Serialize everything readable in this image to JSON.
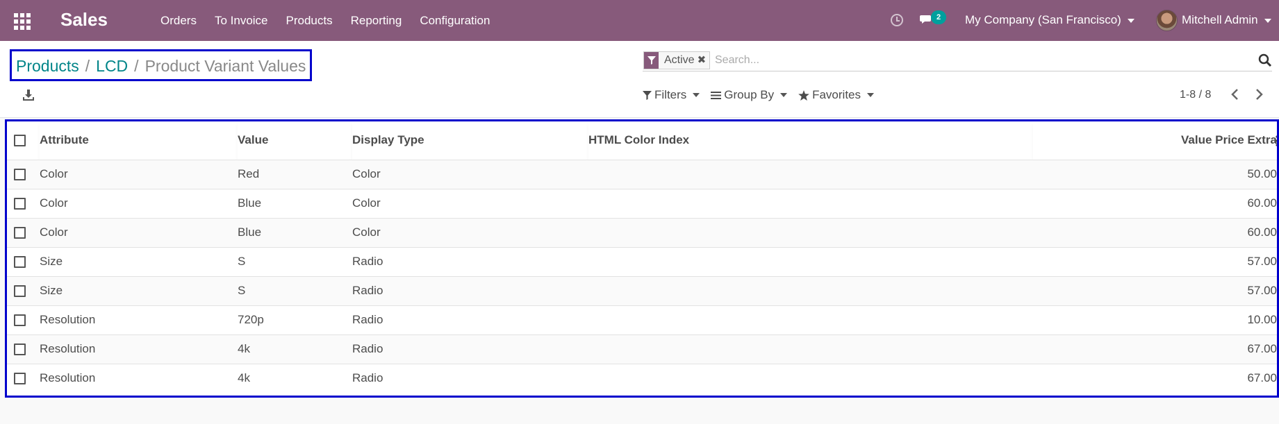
{
  "app": {
    "name": "Sales",
    "menu": [
      "Orders",
      "To Invoice",
      "Products",
      "Reporting",
      "Configuration"
    ],
    "chat_count": "2",
    "company": "My Company (San Francisco)",
    "user": "Mitchell Admin",
    "accent_color": "#875a7b"
  },
  "breadcrumb": {
    "items": [
      "Products",
      "LCD"
    ],
    "current": "Product Variant Values"
  },
  "search": {
    "facet": "Active",
    "placeholder": "Search..."
  },
  "toolbar": {
    "filters": "Filters",
    "group_by": "Group By",
    "favorites": "Favorites",
    "pager": "1-8 / 8"
  },
  "table": {
    "columns": [
      "Attribute",
      "Value",
      "Display Type",
      "HTML Color Index",
      "Value Price Extra"
    ],
    "rows": [
      {
        "attribute": "Color",
        "value": "Red",
        "display_type": "Color",
        "html_color": "",
        "price_extra": "50.00"
      },
      {
        "attribute": "Color",
        "value": "Blue",
        "display_type": "Color",
        "html_color": "",
        "price_extra": "60.00"
      },
      {
        "attribute": "Color",
        "value": "Blue",
        "display_type": "Color",
        "html_color": "",
        "price_extra": "60.00"
      },
      {
        "attribute": "Size",
        "value": "S",
        "display_type": "Radio",
        "html_color": "",
        "price_extra": "57.00"
      },
      {
        "attribute": "Size",
        "value": "S",
        "display_type": "Radio",
        "html_color": "",
        "price_extra": "57.00"
      },
      {
        "attribute": "Resolution",
        "value": "720p",
        "display_type": "Radio",
        "html_color": "",
        "price_extra": "10.00"
      },
      {
        "attribute": "Resolution",
        "value": "4k",
        "display_type": "Radio",
        "html_color": "",
        "price_extra": "67.00"
      },
      {
        "attribute": "Resolution",
        "value": "4k",
        "display_type": "Radio",
        "html_color": "",
        "price_extra": "67.00"
      }
    ]
  }
}
